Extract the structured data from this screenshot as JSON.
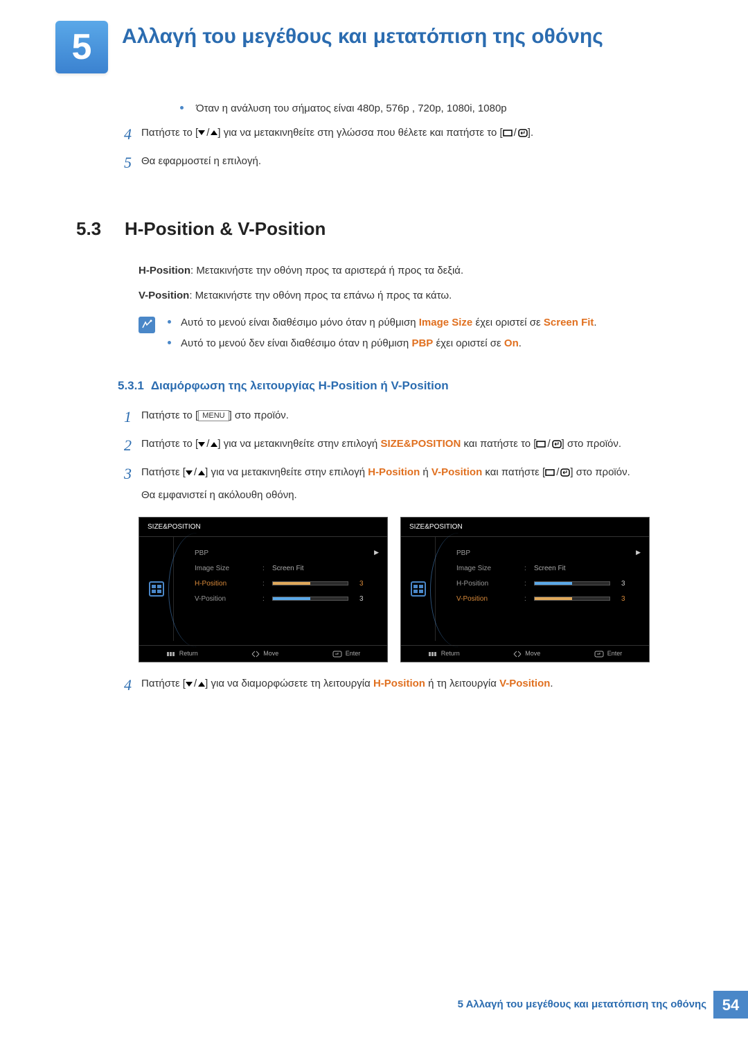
{
  "chapter": {
    "number": "5",
    "title": "Αλλαγή του μεγέθους και μετατόπιση της οθόνης"
  },
  "intro_bullet": "Όταν η ανάλυση του σήματος είναι 480p, 576p , 720p, 1080i, 1080p",
  "step4a_pre": "Πατήστε το [",
  "step4a_mid": "] για να μετακινηθείτε στη γλώσσα που θέλετε και πατήστε το [",
  "step4a_post": "].",
  "step5a": "Θα εφαρμοστεί η επιλογή.",
  "section": {
    "num": "5.3",
    "title": "H-Position & V-Position"
  },
  "hpos_label": "H-Position",
  "hpos_desc": ": Μετακινήστε την οθόνη προς τα αριστερά ή προς τα δεξιά.",
  "vpos_label": "V-Position",
  "vpos_desc": ": Μετακινήστε την οθόνη προς τα επάνω ή προς τα κάτω.",
  "note1_pre": "Αυτό το μενού είναι διαθέσιμο μόνο όταν η ρύθμιση ",
  "note1_term1": "Image Size",
  "note1_mid": " έχει οριστεί σε ",
  "note1_term2": "Screen Fit",
  "note1_post": ".",
  "note2_pre": "Αυτό το μενού δεν είναι διαθέσιμο όταν η ρύθμιση ",
  "note2_term": "PBP",
  "note2_mid": " έχει οριστεί σε ",
  "note2_term2": "On",
  "note2_post": ".",
  "subsection": {
    "num": "5.3.1",
    "title": "Διαμόρφωση της λειτουργίας H-Position ή  V-Position"
  },
  "steps": {
    "s1_pre": "Πατήστε το [",
    "s1_menu": "MENU",
    "s1_post": "] στο προϊόν.",
    "s2_pre": "Πατήστε το [",
    "s2_mid": "] για να μετακινηθείτε στην επιλογή ",
    "s2_term": "SIZE&POSITION",
    "s2_mid2": " και πατήστε το [",
    "s2_post": "] στο προϊόν.",
    "s3_pre": "Πατήστε [",
    "s3_mid": "] για να μετακινηθείτε στην επιλογή ",
    "s3_t1": "H-Position",
    "s3_or": " ή ",
    "s3_t2": "V-Position",
    "s3_mid2": " και πατήστε [",
    "s3_post": "] στο προϊόν.",
    "s3_sub": "Θα εμφανιστεί η ακόλουθη οθόνη.",
    "s4_pre": "Πατήστε [",
    "s4_mid": "] για να διαμορφώσετε τη λειτουργία ",
    "s4_t1": "H-Position",
    "s4_or": " ή τη λειτουργία ",
    "s4_t2": "V-Position",
    "s4_post": "."
  },
  "osd": {
    "title": "SIZE&POSITION",
    "items": {
      "pbp": "PBP",
      "image_size": "Image Size",
      "screen_fit": "Screen Fit",
      "hpos": "H-Position",
      "vpos": "V-Position",
      "val": "3"
    },
    "footer": {
      "return": "Return",
      "move": "Move",
      "enter": "Enter"
    }
  },
  "footer": {
    "text": "5 Αλλαγή του μεγέθους και μετατόπιση της οθόνης",
    "page": "54"
  }
}
